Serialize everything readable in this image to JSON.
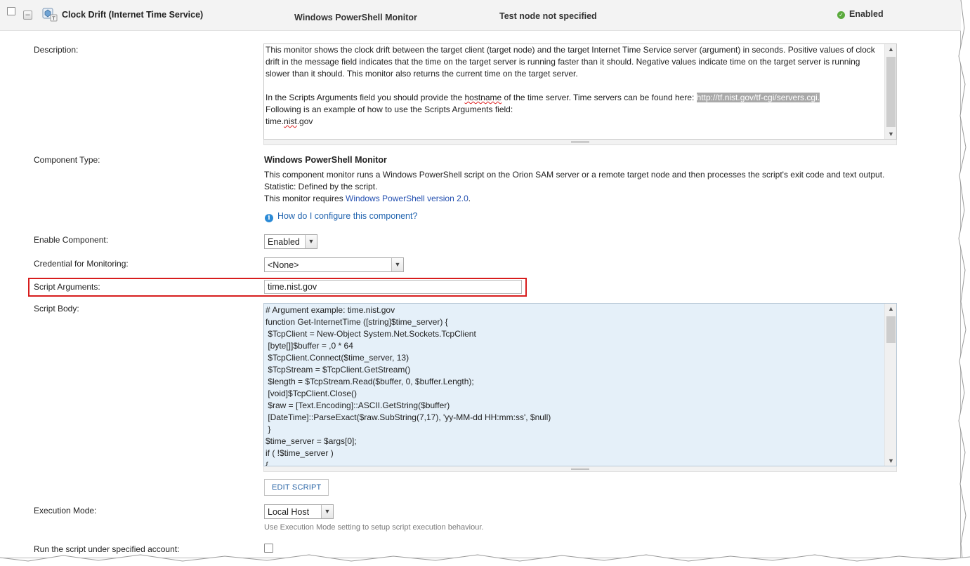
{
  "header": {
    "title": "Clock Drift (Internet Time Service)",
    "type": "Windows PowerShell Monitor",
    "node": "Test node not specified",
    "status": "Enabled"
  },
  "description": {
    "label": "Description:",
    "para1": "This monitor shows the clock drift between the target client (target node) and the target Internet Time Service server (argument) in seconds. Positive values of clock drift in the message field indicates that the time on the target server is running faster than it should. Negative values indicate time on the target server is running slower than it should. This monitor also returns the current time on the target server.",
    "para2_prefix": "In the Scripts Arguments field you should provide the ",
    "para2_word": "hostname",
    "para2_mid": " of the time server. Time servers can be found here: ",
    "para2_link": "http://tf.nist.gov/tf-cgi/servers.cgi.",
    "para3": "Following is an example of how to use the Scripts Arguments field:",
    "example_a": "time.",
    "example_b": "nist",
    "example_c": ".gov"
  },
  "component_type": {
    "label": "Component Type:",
    "value": "Windows PowerShell Monitor",
    "desc": "This component monitor runs a Windows PowerShell script on the Orion SAM server or a remote target node and then processes the script's exit code and text output. Statistic: Defined by the script.",
    "requires_prefix": "This monitor requires ",
    "requires_link": "Windows PowerShell version 2.0",
    "requires_suffix": ".",
    "help_link": "How do I configure this component?"
  },
  "enable_component": {
    "label": "Enable Component:",
    "value": "Enabled"
  },
  "credential": {
    "label": "Credential for Monitoring:",
    "value": "<None>"
  },
  "script_arguments": {
    "label": "Script Arguments:",
    "value": "time.nist.gov"
  },
  "script_body": {
    "label": "Script Body:",
    "lines": [
      "# Argument example: time.nist.gov",
      "function Get-InternetTime ([string]$time_server) {",
      " $TcpClient = New-Object System.Net.Sockets.TcpClient",
      " [byte[]]$buffer = ,0 * 64",
      " $TcpClient.Connect($time_server, 13)",
      " $TcpStream = $TcpClient.GetStream()",
      " $length = $TcpStream.Read($buffer, 0, $buffer.Length);",
      " [void]$TcpClient.Close()",
      " $raw = [Text.Encoding]::ASCII.GetString($buffer)",
      " [DateTime]::ParseExact($raw.SubString(7,17), 'yy-MM-dd HH:mm:ss', $null)",
      " }",
      "$time_server = $args[0];",
      "if ( !$time_server )",
      "{"
    ],
    "edit_button": "EDIT SCRIPT"
  },
  "execution_mode": {
    "label": "Execution Mode:",
    "value": "Local Host",
    "hint": "Use Execution Mode setting to setup script execution behaviour."
  },
  "run_under_account": {
    "label": "Run the script under specified account:"
  },
  "icons": {
    "collapse": "minus-icon",
    "component": "powershell-component-icon",
    "status": "check-circle-icon",
    "info": "info-icon",
    "dropdown": "chevron-down-icon"
  },
  "colors": {
    "highlight_border": "#d71d1d",
    "link": "#2450b0",
    "script_bg": "#e5f0f9",
    "status_ok": "#5aaa3c"
  }
}
